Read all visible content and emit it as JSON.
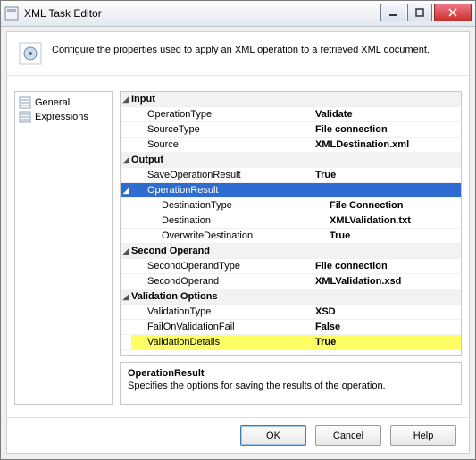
{
  "window": {
    "title": "XML Task Editor"
  },
  "description": "Configure the properties used to apply an XML operation to a retrieved XML document.",
  "sidebar": {
    "items": [
      {
        "label": "General"
      },
      {
        "label": "Expressions"
      }
    ]
  },
  "grid": {
    "cat_input": "Input",
    "operationType_label": "OperationType",
    "operationType_value": "Validate",
    "sourceType_label": "SourceType",
    "sourceType_value": "File connection",
    "source_label": "Source",
    "source_value": "XMLDestination.xml",
    "cat_output": "Output",
    "saveOpResult_label": "SaveOperationResult",
    "saveOpResult_value": "True",
    "opResult_label": "OperationResult",
    "destType_label": "DestinationType",
    "destType_value": "File Connection",
    "destination_label": "Destination",
    "destination_value": "XMLValidation.txt",
    "overwrite_label": "OverwriteDestination",
    "overwrite_value": "True",
    "cat_secop": "Second Operand",
    "secOpType_label": "SecondOperandType",
    "secOpType_value": "File connection",
    "secOp_label": "SecondOperand",
    "secOp_value": "XMLValidation.xsd",
    "cat_valopt": "Validation Options",
    "valType_label": "ValidationType",
    "valType_value": "XSD",
    "failOnVal_label": "FailOnValidationFail",
    "failOnVal_value": "False",
    "valDetails_label": "ValidationDetails",
    "valDetails_value": "True"
  },
  "help": {
    "title": "OperationResult",
    "text": "Specifies the options for saving the results of the operation."
  },
  "buttons": {
    "ok": "OK",
    "cancel": "Cancel",
    "help": "Help"
  }
}
